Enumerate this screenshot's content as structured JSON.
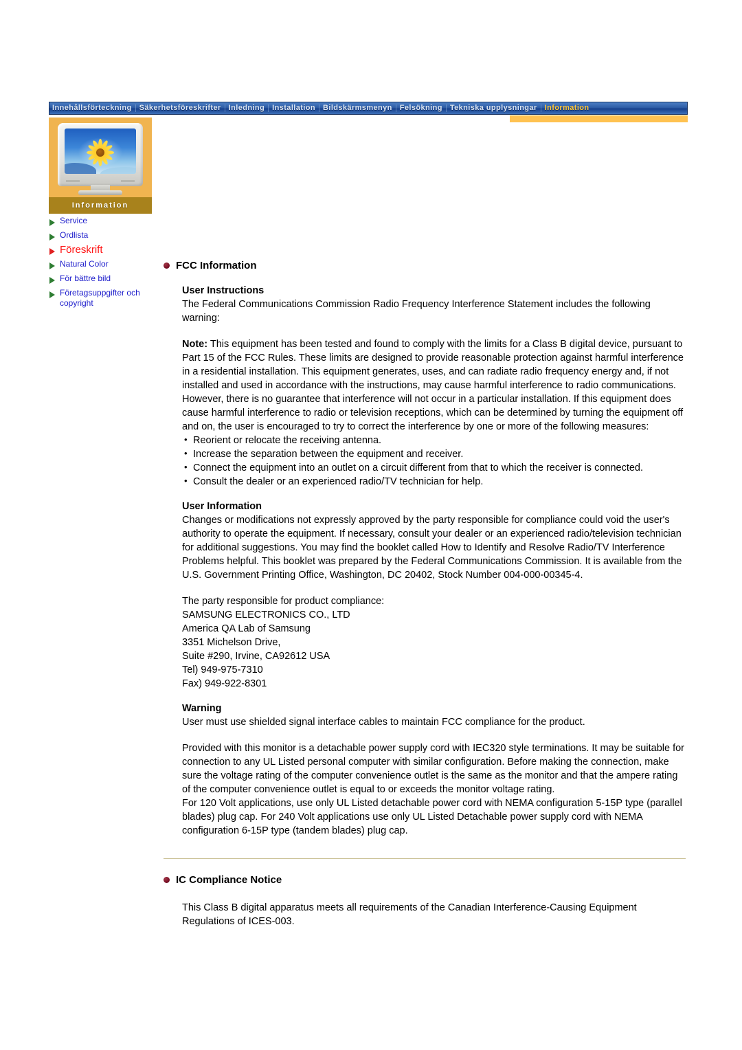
{
  "nav": {
    "items": [
      {
        "label": "Innehållsförteckning",
        "active": false
      },
      {
        "label": "Säkerhetsföreskrifter",
        "active": false
      },
      {
        "label": "Inledning",
        "active": false
      },
      {
        "label": "Installation",
        "active": false
      },
      {
        "label": "Bildskärmsmenyn",
        "active": false
      },
      {
        "label": "Felsökning",
        "active": false
      },
      {
        "label": "Tekniska upplysningar",
        "active": false
      },
      {
        "label": "Information",
        "active": true
      }
    ]
  },
  "sidebar": {
    "banner_label": "Information",
    "monitor_icon": "crt-monitor-sunflower-image",
    "items": [
      {
        "label": "Service",
        "active": false
      },
      {
        "label": "Ordlista",
        "active": false
      },
      {
        "label": "Föreskrift",
        "active": true
      },
      {
        "label": "Natural Color",
        "active": false
      },
      {
        "label": "För bättre bild",
        "active": false
      },
      {
        "label": "Företagsuppgifter och copyright",
        "active": false
      }
    ]
  },
  "main": {
    "fcc": {
      "title": "FCC Information",
      "user_instructions_heading": "User Instructions",
      "user_instructions_intro": "The Federal Communications Commission Radio Frequency Interference Statement includes the following warning:",
      "note_label": "Note:",
      "note_text": "This equipment has been tested and found to comply with the limits for a Class B digital device, pursuant to Part 15 of the FCC Rules. These limits are designed to provide reasonable protection against harmful interference in a residential installation. This equipment generates, uses, and can radiate radio frequency energy and, if not installed and used in accordance with the instructions, may cause harmful interference to radio communications. However, there is no guarantee that interference will not occur in a particular installation. If this equipment does cause harmful interference to radio or television receptions, which can be determined by turning the equipment off and on, the user is encouraged to try to correct the interference by one or more of the following measures:",
      "measures": [
        "Reorient or relocate the receiving antenna.",
        "Increase the separation between the equipment and receiver.",
        "Connect the equipment into an outlet on a circuit different from that to which the receiver is connected.",
        "Consult the dealer or an experienced radio/TV technician for help."
      ],
      "user_information_heading": "User Information",
      "user_information_text": "Changes or modifications not expressly approved by the party responsible for compliance could void the user's authority to operate the equipment. If necessary, consult your dealer or an experienced radio/television technician for additional suggestions. You may find the booklet called How to Identify and Resolve Radio/TV Interference Problems helpful. This booklet was prepared by the Federal Communications Commission. It is available from the U.S. Government Printing Office, Washington, DC 20402, Stock Number 004-000-00345-4.",
      "responsible_party_lines": [
        "The party responsible for product compliance:",
        "SAMSUNG ELECTRONICS CO., LTD",
        "America QA Lab of Samsung",
        "3351 Michelson Drive,",
        "Suite #290, Irvine, CA92612 USA",
        "Tel) 949-975-7310",
        "Fax) 949-922-8301"
      ],
      "warning_heading": "Warning",
      "warning_text": "User must use shielded signal interface cables to maintain FCC compliance for the product.",
      "power_cord_text": "Provided with this monitor is a detachable power supply cord with IEC320 style terminations. It may be suitable for connection to any UL Listed personal computer with similar configuration. Before making the connection, make sure the voltage rating of the computer convenience outlet is the same as the monitor and that the ampere rating of the computer convenience outlet is equal to or exceeds the monitor voltage rating.",
      "nema_text": "For 120 Volt applications, use only UL Listed detachable power cord with NEMA configuration 5-15P type (parallel blades) plug cap. For 240 Volt applications use only UL Listed Detachable power supply cord with NEMA configuration 6-15P type (tandem blades) plug cap."
    },
    "ic": {
      "title": "IC Compliance Notice",
      "text": "This Class B digital apparatus meets all requirements of the Canadian Interference-Causing Equipment Regulations of ICES-003."
    }
  },
  "colors": {
    "nav_bg": "#2e5ca5",
    "nav_active_text": "#ffc83c",
    "sidebar_bg": "#f0b450",
    "sidebar_band": "#a8821c",
    "link_blue": "#2020cc",
    "active_red": "#ff1414",
    "bullet_maroon": "#7a1026",
    "yellow_bar": "#ffc251",
    "divider": "#c9bf93"
  }
}
